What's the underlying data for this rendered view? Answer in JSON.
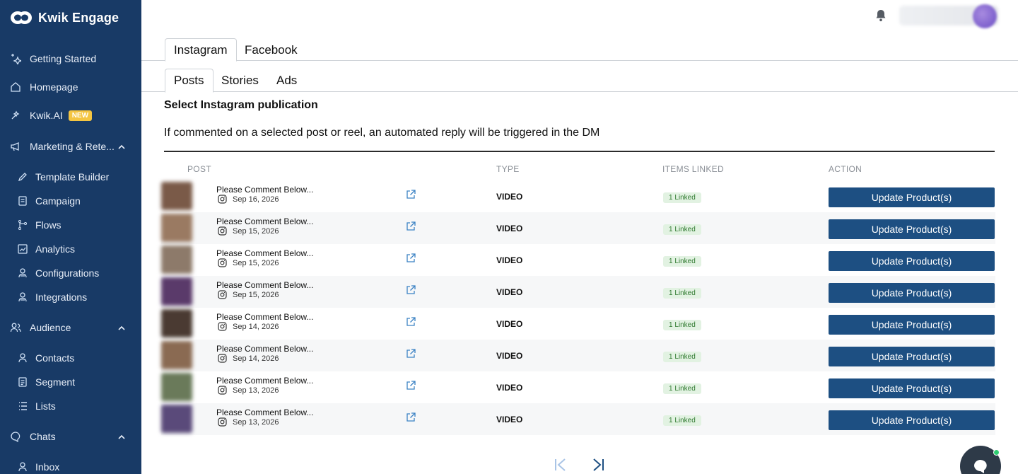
{
  "app": {
    "brand_name": "Kwik Engage"
  },
  "sidebar": {
    "getting_started": "Getting Started",
    "homepage": "Homepage",
    "kwik_ai": "Kwik.AI",
    "kwik_ai_badge": "NEW",
    "marketing": "Marketing & Rete...",
    "template_builder": "Template Builder",
    "campaign": "Campaign",
    "flows": "Flows",
    "analytics": "Analytics",
    "configurations": "Configurations",
    "integrations": "Integrations",
    "audience": "Audience",
    "contacts": "Contacts",
    "segment": "Segment",
    "lists": "Lists",
    "chats": "Chats",
    "inbox": "Inbox"
  },
  "tabs": {
    "platform": [
      "Instagram",
      "Facebook"
    ],
    "content": [
      "Posts",
      "Stories",
      "Ads"
    ]
  },
  "main": {
    "heading": "Select Instagram publication",
    "description": "If commented on a selected post or reel, an automated reply will be triggered in the DM"
  },
  "table": {
    "headers": {
      "post": "POST",
      "type": "TYPE",
      "items_linked": "ITEMS LINKED",
      "action": "ACTION"
    },
    "rows": [
      {
        "title": "Please Comment Below...",
        "date": "Sep 16, 2026",
        "type": "VIDEO",
        "linked": "1 Linked",
        "action": "Update Product(s)",
        "thumb_color": "#7a5a48"
      },
      {
        "title": "Please Comment Below...",
        "date": "Sep 15, 2026",
        "type": "VIDEO",
        "linked": "1 Linked",
        "action": "Update Product(s)",
        "thumb_color": "#9a7a62"
      },
      {
        "title": "Please Comment Below...",
        "date": "Sep 15, 2026",
        "type": "VIDEO",
        "linked": "1 Linked",
        "action": "Update Product(s)",
        "thumb_color": "#8d7a6a"
      },
      {
        "title": "Please Comment Below...",
        "date": "Sep 15, 2026",
        "type": "VIDEO",
        "linked": "1 Linked",
        "action": "Update Product(s)",
        "thumb_color": "#5a3a6a"
      },
      {
        "title": "Please Comment Below...",
        "date": "Sep 14, 2026",
        "type": "VIDEO",
        "linked": "1 Linked",
        "action": "Update Product(s)",
        "thumb_color": "#4a3a32"
      },
      {
        "title": "Please Comment Below...",
        "date": "Sep 14, 2026",
        "type": "VIDEO",
        "linked": "1 Linked",
        "action": "Update Product(s)",
        "thumb_color": "#8a6a52"
      },
      {
        "title": "Please Comment Below...",
        "date": "Sep 13, 2026",
        "type": "VIDEO",
        "linked": "1 Linked",
        "action": "Update Product(s)",
        "thumb_color": "#6a7a5a"
      },
      {
        "title": "Please Comment Below...",
        "date": "Sep 13, 2026",
        "type": "VIDEO",
        "linked": "1 Linked",
        "action": "Update Product(s)",
        "thumb_color": "#5a4a7a"
      }
    ]
  },
  "colors": {
    "sidebar_bg": "#183a66",
    "button_bg": "#1d4f82",
    "badge_new": "#f4c542",
    "linked_bg": "#e2f2e2"
  },
  "icons": [
    "bell-icon",
    "instagram-icon",
    "external-link-icon",
    "first-page-icon",
    "last-page-icon",
    "chat-icon"
  ]
}
